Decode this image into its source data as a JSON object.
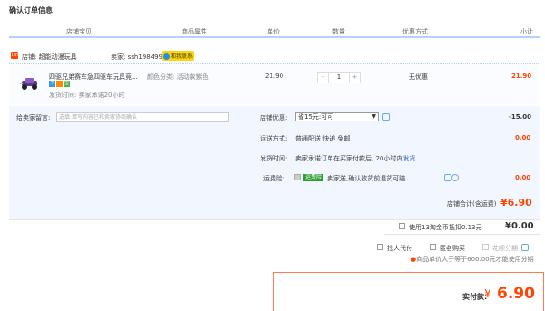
{
  "page_title": "确认订单信息",
  "headers": {
    "shop_item": "店铺宝贝",
    "attr": "商品属性",
    "price": "单价",
    "qty": "数量",
    "discount": "优惠方式",
    "subtotal": "小计"
  },
  "shop": {
    "logo": "Tm",
    "label": "店铺: 超能动漫玩具",
    "seller": "卖家: ssh198499",
    "contact": "和我联系"
  },
  "item": {
    "name": "四驱兄弟赛车急四驱车玩具竞...",
    "color": "颜色分类: 活动款紫色",
    "delivery": "发货时间: 卖家承诺20小时",
    "price": "21.90",
    "qty": "1",
    "qty_minus": "-",
    "qty_plus": "+",
    "discount": "无优惠",
    "subtotal": "21.90",
    "badges": [
      "7",
      "",
      "宝"
    ]
  },
  "message": {
    "label": "给卖家留言:",
    "placeholder": "选填:填写内容已和卖家协商确认"
  },
  "coupon": {
    "label": "店铺优惠:",
    "value": "省15元:可可",
    "amount": "-15.00"
  },
  "shipping": {
    "label": "运送方式:",
    "value": "普通配送 快递 免邮",
    "amount": "0.00"
  },
  "deliver": {
    "label": "发货时间:",
    "value": "卖家承诺订单在买家付款后, 20小时内",
    "link": "发货"
  },
  "insurance": {
    "label": "运费险:",
    "tag": "运费险",
    "value": "卖家送,确认收货前退货可赔",
    "amount": "0.00"
  },
  "shop_total": {
    "label": "店铺合计(含运费)",
    "amount": "¥6.90"
  },
  "coins": {
    "label": "使用13淘金币抵扣0.13元",
    "amount": "¥0.00"
  },
  "options": {
    "agent": "找人代付",
    "anonymous": "匿名购买",
    "installment": "花呗分期",
    "note": "商品单价大于等于600.00元才能使用分期"
  },
  "pay": {
    "label": "实付款:",
    "currency": "¥",
    "amount": "6.90"
  },
  "colors": {
    "accent": "#ff4400",
    "header_line": "#b2d1ff",
    "light_blue_bg": "#f2f7ff",
    "contact_bg": "#ffd600"
  }
}
